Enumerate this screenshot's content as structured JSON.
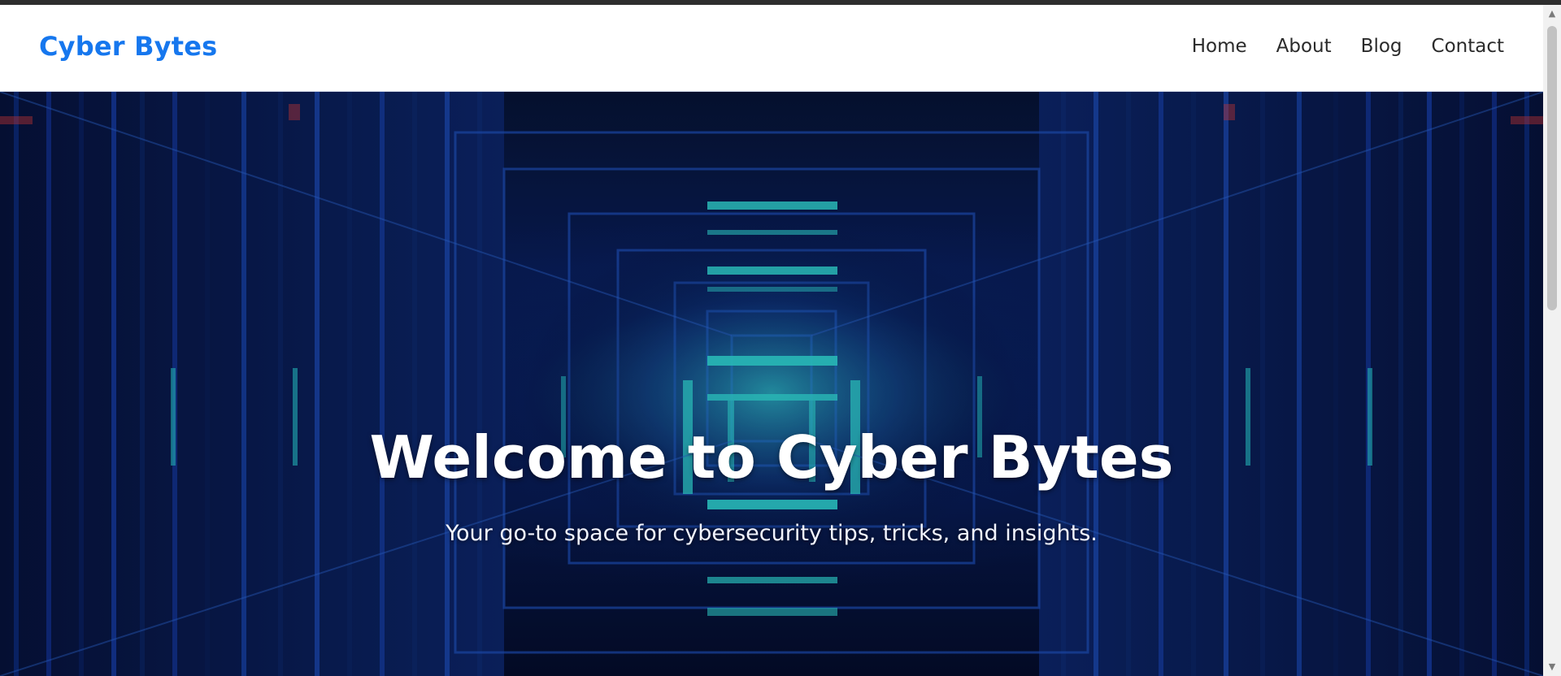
{
  "brand": {
    "name": "Cyber Bytes",
    "color": "#1677ee"
  },
  "nav": {
    "items": [
      {
        "label": "Home"
      },
      {
        "label": "About"
      },
      {
        "label": "Blog"
      },
      {
        "label": "Contact"
      }
    ]
  },
  "hero": {
    "title": "Welcome to Cyber Bytes",
    "subtitle": "Your go-to space for cybersecurity tips, tricks, and insights.",
    "background": "server-corridor-image",
    "accent_colors": [
      "#0a1d5c",
      "#2ad6d6",
      "#1c3fa8"
    ]
  },
  "scrollbar": {
    "up_icon": "triangle-up-icon",
    "down_icon": "triangle-down-icon"
  }
}
